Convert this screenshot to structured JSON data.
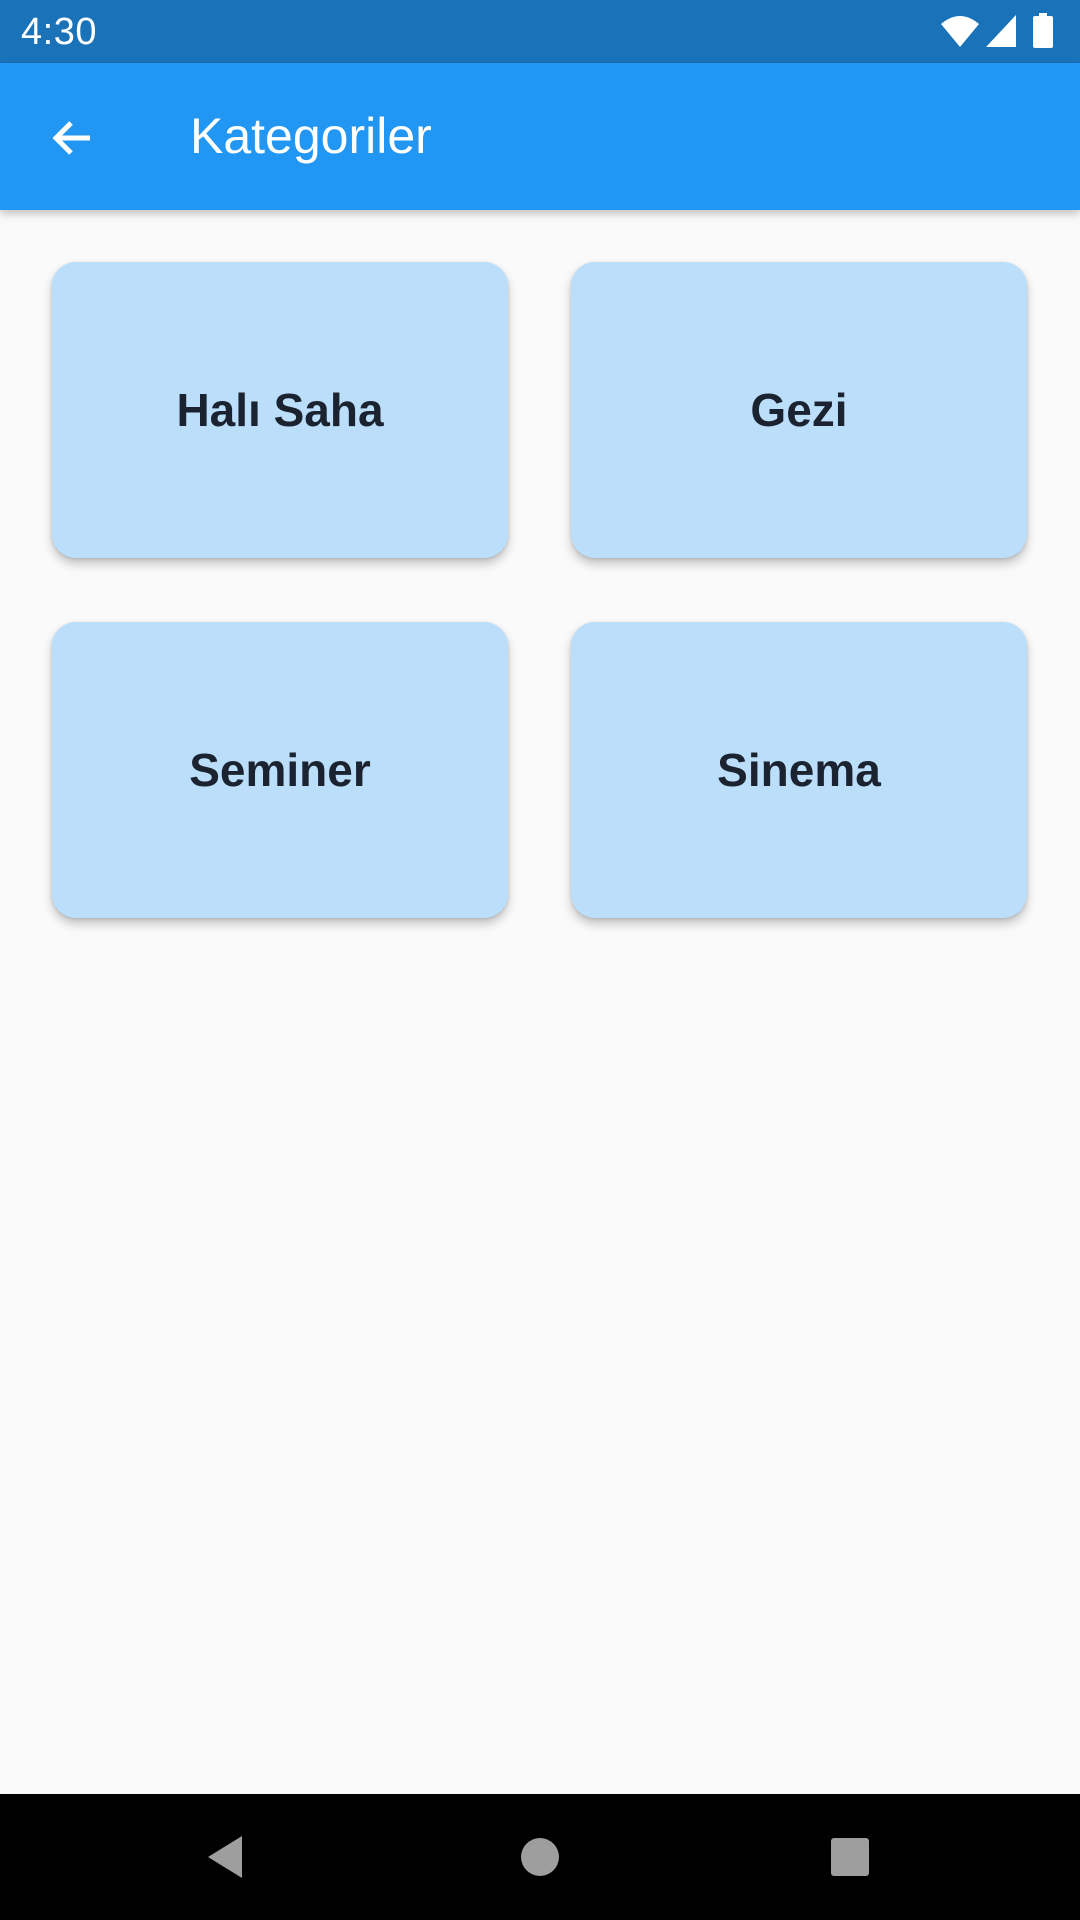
{
  "status_bar": {
    "time": "4:30",
    "icons": [
      "wifi-icon",
      "cellular-signal-icon",
      "battery-icon"
    ]
  },
  "app_bar": {
    "title": "Kategoriler",
    "back_icon": "arrow-back-icon",
    "background_color": "#2196f3"
  },
  "categories": [
    {
      "label": "Halı Saha"
    },
    {
      "label": "Gezi"
    },
    {
      "label": "Seminer"
    },
    {
      "label": "Sinema"
    }
  ],
  "colors": {
    "status_bar": "#1a72b8",
    "card_background": "#bbdefb",
    "card_text": "#1c2330",
    "page_background": "#fafafa"
  },
  "nav_bar": {
    "buttons": [
      "nav-back-icon",
      "nav-home-icon",
      "nav-recent-apps-icon"
    ]
  }
}
